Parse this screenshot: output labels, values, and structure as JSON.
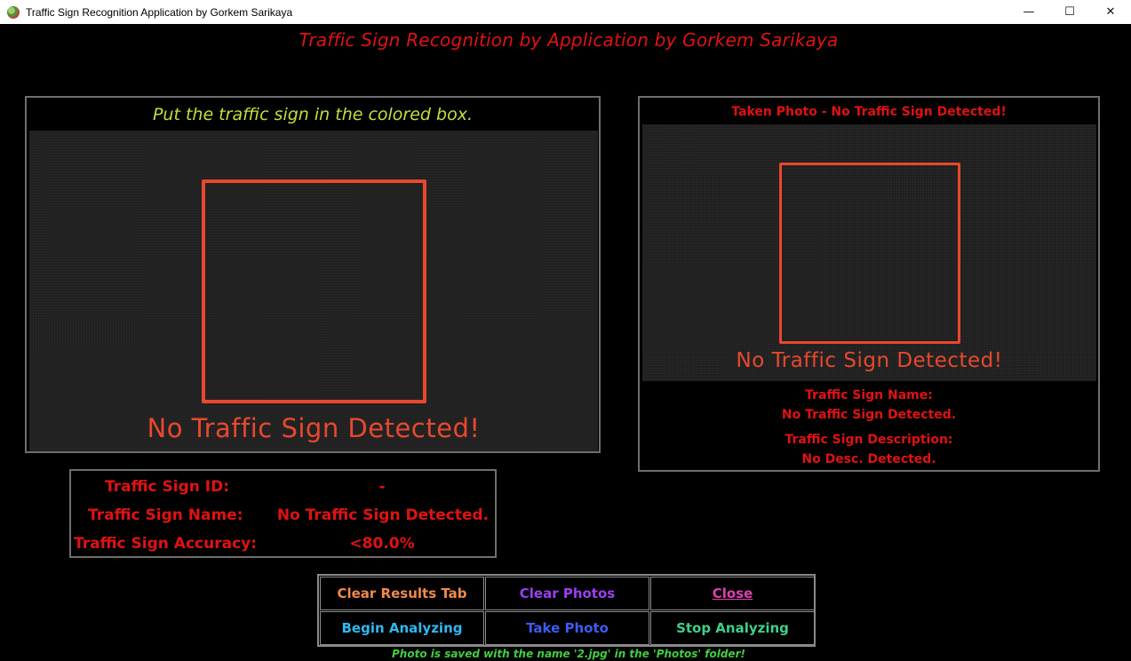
{
  "window": {
    "title": "Traffic Sign Recognition Application by Gorkem Sarikaya",
    "minimize_glyph": "—",
    "maximize_glyph": "☐",
    "close_glyph": "✕"
  },
  "heading": "Traffic Sign Recognition by Application by Gorkem Sarikaya",
  "live_panel": {
    "caption": "Put the traffic sign in the colored box.",
    "overlay_text": "No Traffic Sign Detected!"
  },
  "photo_panel": {
    "title": "Taken Photo - No Traffic Sign Detected!",
    "overlay_text": "No Traffic Sign Detected!",
    "name_label": "Traffic Sign Name:",
    "name_value": "No Traffic Sign Detected.",
    "description_label": "Traffic Sign Description:",
    "description_value": "No Desc. Detected."
  },
  "results": {
    "id_label": "Traffic Sign ID:",
    "id_value": "-",
    "name_label": "Traffic Sign Name:",
    "name_value": "No Traffic Sign Detected.",
    "accuracy_label": "Traffic Sign Accuracy:",
    "accuracy_value": "<80.0%"
  },
  "buttons": {
    "clear_results": "Clear Results Tab",
    "clear_photos": "Clear Photos",
    "close": "Close",
    "begin_analyzing": "Begin Analyzing",
    "take_photo": "Take Photo",
    "stop_analyzing": "Stop Analyzing"
  },
  "status": "Photo is saved with the name '2.jpg' in the 'Photos' folder!",
  "colors": {
    "accent_red": "#e01212",
    "overlay_red": "#e8482e",
    "caption_yellow": "#c8dc3c",
    "clear_results": "#f08a4b",
    "clear_photos": "#9b3ff0",
    "close": "#e040b0",
    "begin_analyzing": "#2fb8f0",
    "take_photo": "#3d5cf0",
    "stop_analyzing": "#3fd08a",
    "status_green": "#3fcf3f"
  },
  "icons": {
    "app": "app-logo-icon"
  }
}
